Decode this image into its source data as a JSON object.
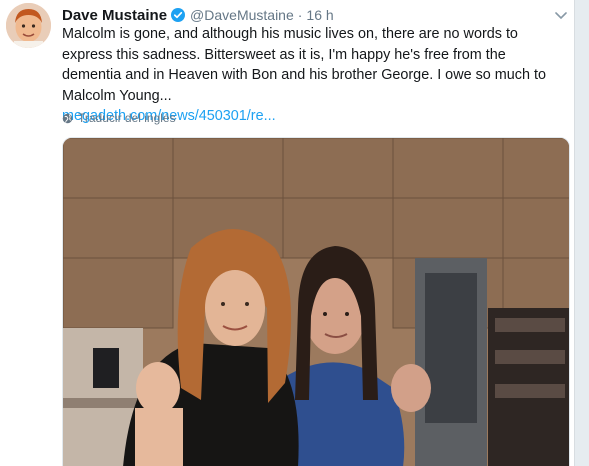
{
  "tweet": {
    "author_name": "Dave Mustaine",
    "author_handle": "@DaveMustaine",
    "separator": "·",
    "time": "16 h",
    "text": "Malcolm is gone, and although his music lives on, there are no words to express this sadness. Bittersweet as it is, I'm happy he's free from the dementia and in Heaven with Bon and his brother George. I owe so much to Malcolm Young...",
    "link": "megadeth.com/news/450301/re...",
    "translate_label": "Traducir del inglés"
  },
  "icons": {
    "verified": "verified-badge-icon",
    "caret": "chevron-down-icon",
    "globe": "globe-icon"
  },
  "colors": {
    "link": "#1da1f2",
    "secondary_text": "#657786",
    "primary_text": "#14171a"
  }
}
